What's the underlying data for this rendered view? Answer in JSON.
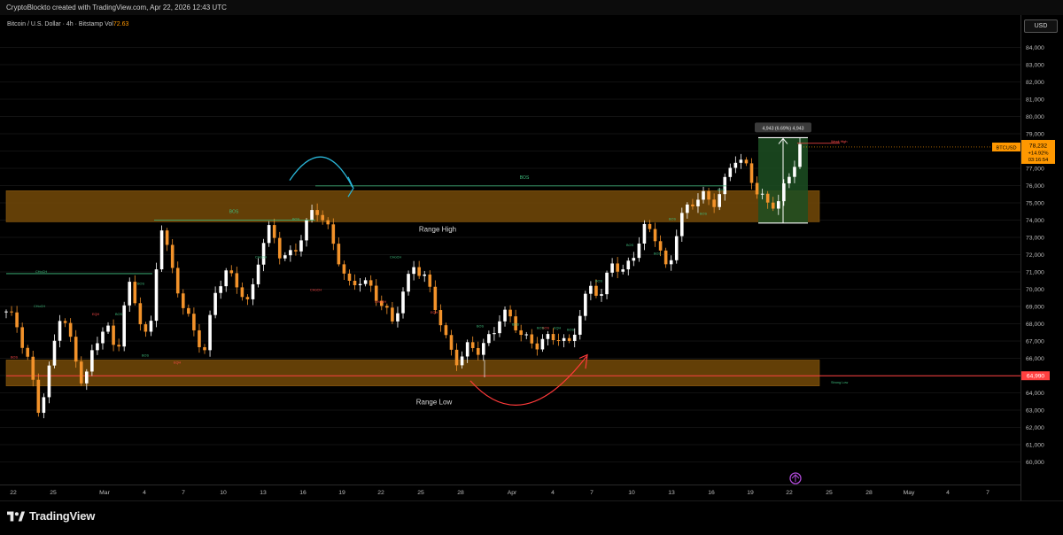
{
  "header": {
    "attribution": "CryptoBlockto created with TradingView.com, Apr 22, 2026 12:43 UTC"
  },
  "symbol_info": {
    "title": "Bitcoin / U.S. Dollar · 4h · Bitstamp",
    "vol_label": "Vol",
    "vol_value": "72.63"
  },
  "currency_button": "USD",
  "footer": {
    "brand": "TradingView"
  },
  "colors": {
    "background": "#000000",
    "up_candle": "#ffffff",
    "down_candle": "#f2922a",
    "zone_fill": "#6b4408",
    "range_line": "#ff4040",
    "measure_fill": "#1c4f22",
    "structure_green": "#3fbf7f",
    "structure_red": "#ff4a4a",
    "price_tag": "#ff9800"
  },
  "chart_data": {
    "type": "candlestick",
    "symbol": "BTCUSD",
    "timeframe": "4h",
    "exchange": "Bitstamp",
    "ylim": [
      59000,
      85000
    ],
    "y_ticks": [
      60000,
      61000,
      62000,
      63000,
      64000,
      65000,
      66000,
      67000,
      68000,
      69000,
      70000,
      71000,
      72000,
      73000,
      74000,
      75000,
      76000,
      77000,
      78000,
      79000,
      80000,
      81000,
      82000,
      83000,
      84000
    ],
    "y_tick_labels": [
      "60,000",
      "61,000",
      "62,000",
      "63,000",
      "64,000",
      "65,000",
      "66,000",
      "67,000",
      "68,000",
      "69,000",
      "70,000",
      "71,000",
      "72,000",
      "73,000",
      "74,000",
      "75,000",
      "76,000",
      "77,000",
      "78,000",
      "79,000",
      "80,000",
      "81,000",
      "82,000",
      "83,000",
      "84,000"
    ],
    "x_ticks": [
      "22",
      "25",
      "Mar",
      "4",
      "7",
      "10",
      "13",
      "16",
      "19",
      "22",
      "25",
      "28",
      "Apr",
      "4",
      "7",
      "10",
      "13",
      "16",
      "19",
      "22",
      "25",
      "28",
      "May",
      "4",
      "7"
    ],
    "close_path": [
      [
        0,
        68500
      ],
      [
        2,
        67800
      ],
      [
        4,
        66000
      ],
      [
        6,
        63000
      ],
      [
        8,
        65500
      ],
      [
        10,
        68700
      ],
      [
        12,
        66500
      ],
      [
        14,
        64700
      ],
      [
        16,
        66800
      ],
      [
        18,
        68000
      ],
      [
        20,
        65800
      ],
      [
        22,
        70500
      ],
      [
        24,
        68800
      ],
      [
        26,
        67000
      ],
      [
        28,
        73800
      ],
      [
        30,
        71000
      ],
      [
        32,
        69200
      ],
      [
        34,
        67800
      ],
      [
        36,
        66500
      ],
      [
        38,
        69800
      ],
      [
        40,
        70800
      ],
      [
        42,
        70400
      ],
      [
        44,
        69200
      ],
      [
        46,
        72200
      ],
      [
        48,
        73400
      ],
      [
        50,
        71600
      ],
      [
        52,
        72200
      ],
      [
        54,
        73600
      ],
      [
        56,
        74800
      ],
      [
        58,
        73500
      ],
      [
        60,
        72000
      ],
      [
        62,
        70300
      ],
      [
        64,
        70800
      ],
      [
        66,
        70000
      ],
      [
        68,
        69000
      ],
      [
        70,
        68000
      ],
      [
        72,
        70000
      ],
      [
        74,
        71600
      ],
      [
        76,
        70500
      ],
      [
        78,
        68700
      ],
      [
        80,
        66800
      ],
      [
        82,
        66000
      ],
      [
        84,
        66900
      ],
      [
        86,
        66300
      ],
      [
        88,
        67100
      ],
      [
        90,
        68700
      ],
      [
        92,
        68400
      ],
      [
        94,
        67200
      ],
      [
        96,
        66600
      ],
      [
        98,
        66900
      ],
      [
        100,
        67400
      ],
      [
        102,
        66900
      ],
      [
        104,
        68500
      ],
      [
        106,
        70000
      ],
      [
        108,
        69500
      ],
      [
        110,
        71800
      ],
      [
        112,
        71100
      ],
      [
        114,
        72200
      ],
      [
        116,
        73400
      ],
      [
        118,
        72900
      ],
      [
        120,
        70900
      ],
      [
        122,
        74200
      ],
      [
        124,
        74800
      ],
      [
        126,
        75300
      ],
      [
        128,
        74800
      ],
      [
        130,
        76000
      ],
      [
        132,
        77900
      ],
      [
        134,
        77100
      ],
      [
        136,
        75600
      ],
      [
        138,
        74800
      ],
      [
        140,
        75300
      ],
      [
        142,
        76600
      ],
      [
        144,
        78200
      ]
    ],
    "annotations": {
      "range_high_label": "Range High",
      "range_low_label": "Range Low",
      "range_high_zone": [
        73900,
        75700
      ],
      "range_low_zone": [
        64400,
        65900
      ],
      "range_low_line": 64990,
      "measure_label": "4,943 (6.69%) 4,943",
      "measure_range": [
        73830,
        78773
      ],
      "weak_high_label": "Weak High",
      "strong_low_label": "Strong Low",
      "bos_labels": [
        "BOS",
        "BOS"
      ],
      "small_labels": [
        "CHoCH",
        "CHoCH",
        "EQH",
        "BOS",
        "BOS",
        "BOS",
        "EQH",
        "CHoCH",
        "BOS",
        "CHoCH",
        "CHoCH",
        "CHoCH",
        "EQH",
        "BOS",
        "BOS",
        "EQH",
        "BOS",
        "BOS",
        "BOS",
        "BOS",
        "BOS",
        "BOS",
        "BOS",
        "BOS",
        "BOS",
        "BOS"
      ]
    },
    "last_price": {
      "symbol_label": "BTCUSD",
      "price": "78,232",
      "change": "+14.92%",
      "countdown": "03:16:54",
      "value": 78232
    },
    "level_tag": {
      "label": "64,990",
      "value": 64990
    }
  }
}
